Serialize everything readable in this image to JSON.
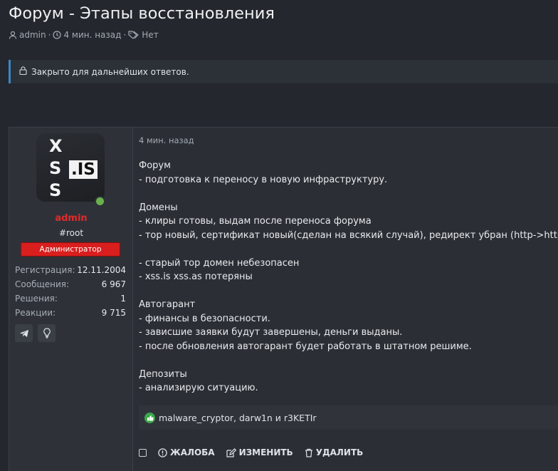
{
  "thread": {
    "title": "Форум - Этапы восстановления",
    "author": "admin",
    "time": "4 мин. назад",
    "tags": "Нет"
  },
  "notice": {
    "text": "Закрыто для дальнейших ответов.",
    "icon": "lock-icon",
    "accent_color": "#3d86c6"
  },
  "post": {
    "user": {
      "avatar_text_letters": [
        "X",
        "S",
        "S"
      ],
      "avatar_text_domain": ".IS",
      "name": "admin",
      "name_color": "#e02b2b",
      "user_title": "#root",
      "banner": "Администратор",
      "banner_color": "#d91e1e",
      "stats": [
        {
          "label": "Регистрация:",
          "value": "12.11.2004"
        },
        {
          "label": "Сообщения:",
          "value": "6 967"
        },
        {
          "label": "Решения:",
          "value": "1"
        },
        {
          "label": "Реакции:",
          "value": "9 715"
        }
      ],
      "contacts": [
        "telegram-icon",
        "lightbulb-icon"
      ]
    },
    "time": "4 мин. назад",
    "lines": [
      "Форум",
      "- подготовка к переносу в новую инфраструктуру.",
      "",
      "Домены",
      "- клиры готовы, выдам после переноса форума",
      "- тор новый, сертификат новый(сделан на всякий случай), редирект убран (http->https).",
      "",
      "- старый тор домен небезопасен",
      "- xss.is xss.as потеряны",
      "",
      "Автогарант",
      "- финансы в безопасности.",
      "- зависшие заявки будут завершены, деньги выданы.",
      "- после обновления автогарант будет работать в штатном решиме.",
      "",
      "Депозиты",
      "- анализирую ситуацию."
    ],
    "reactions": "malware_cryptor, darw1n и r3KETIr",
    "actions": {
      "report": "ЖАЛОБА",
      "edit": "ИЗМЕНИТЬ",
      "delete": "УДАЛИТЬ"
    }
  }
}
